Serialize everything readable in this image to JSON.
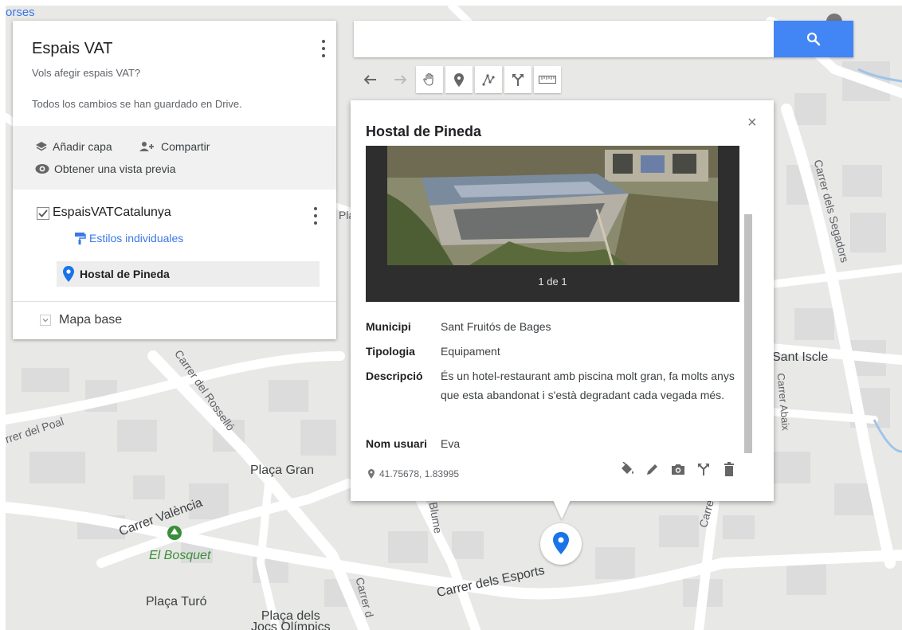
{
  "map_labels": {
    "corner_top_left": "orses",
    "placa_gran": "Plaça Gran",
    "carrer_valencia": "Carrer València",
    "el_bosquet": "El Bosquet",
    "placa_turo": "Plaça Turó",
    "placa_jocs": "Plaça dels\nJocs Olímpics",
    "carrer_esports": "Carrer dels Esports",
    "carrer_segadors": "Carrer dels Segadors",
    "sant_iscle": "Sant Iscle",
    "carrer_abaix": "Carrer Abaix",
    "carrer_rossello": "Carrer del Rosselló",
    "carrer_del_poal": "rrer del Poal",
    "blume": "Blume",
    "carrer_d": "Carrer d",
    "carre": "Carre",
    "pla": "Pla"
  },
  "left_panel": {
    "title": "Espais VAT",
    "description": "Vols afegir espais VAT?",
    "save_status": "Todos los cambios se han guardado en Drive.",
    "add_layer": "Añadir capa",
    "share": "Compartir",
    "preview": "Obtener una vista previa",
    "layer_name": "EspaisVATCatalunya",
    "styles_link": "Estilos individuales",
    "feature_name": "Hostal de Pineda",
    "base_map": "Mapa base"
  },
  "search": {
    "placeholder": ""
  },
  "info_card": {
    "title": "Hostal de Pineda",
    "photo_counter": "1 de 1",
    "attributes": [
      {
        "key": "Municipi",
        "value": "Sant Fruitós de Bages"
      },
      {
        "key": "Tipologia",
        "value": "Equipament"
      },
      {
        "key": "Descripció",
        "value": "És un hotel-restaurant amb piscina molt gran, fa molts anys que esta abandonat i s'està degradant cada vegada més."
      },
      {
        "key": "Nom usuari",
        "value": "Eva"
      }
    ],
    "coordinates": "41.75678, 1.83995"
  },
  "colors": {
    "accent_blue": "#4285f4",
    "marker_blue": "#1a73e8",
    "link_blue": "#3b78e7",
    "map_background": "#e8e8e6",
    "road": "#ffffff",
    "block": "#dcdcdc",
    "park_green": "#3a8e3a"
  },
  "icons": {
    "toolbar": [
      "undo-icon",
      "redo-icon",
      "hand-icon",
      "marker-icon",
      "draw-line-icon",
      "directions-icon",
      "ruler-icon"
    ],
    "card_actions": [
      "paint-bucket-icon",
      "pencil-icon",
      "camera-icon",
      "directions-icon",
      "trash-icon"
    ]
  }
}
